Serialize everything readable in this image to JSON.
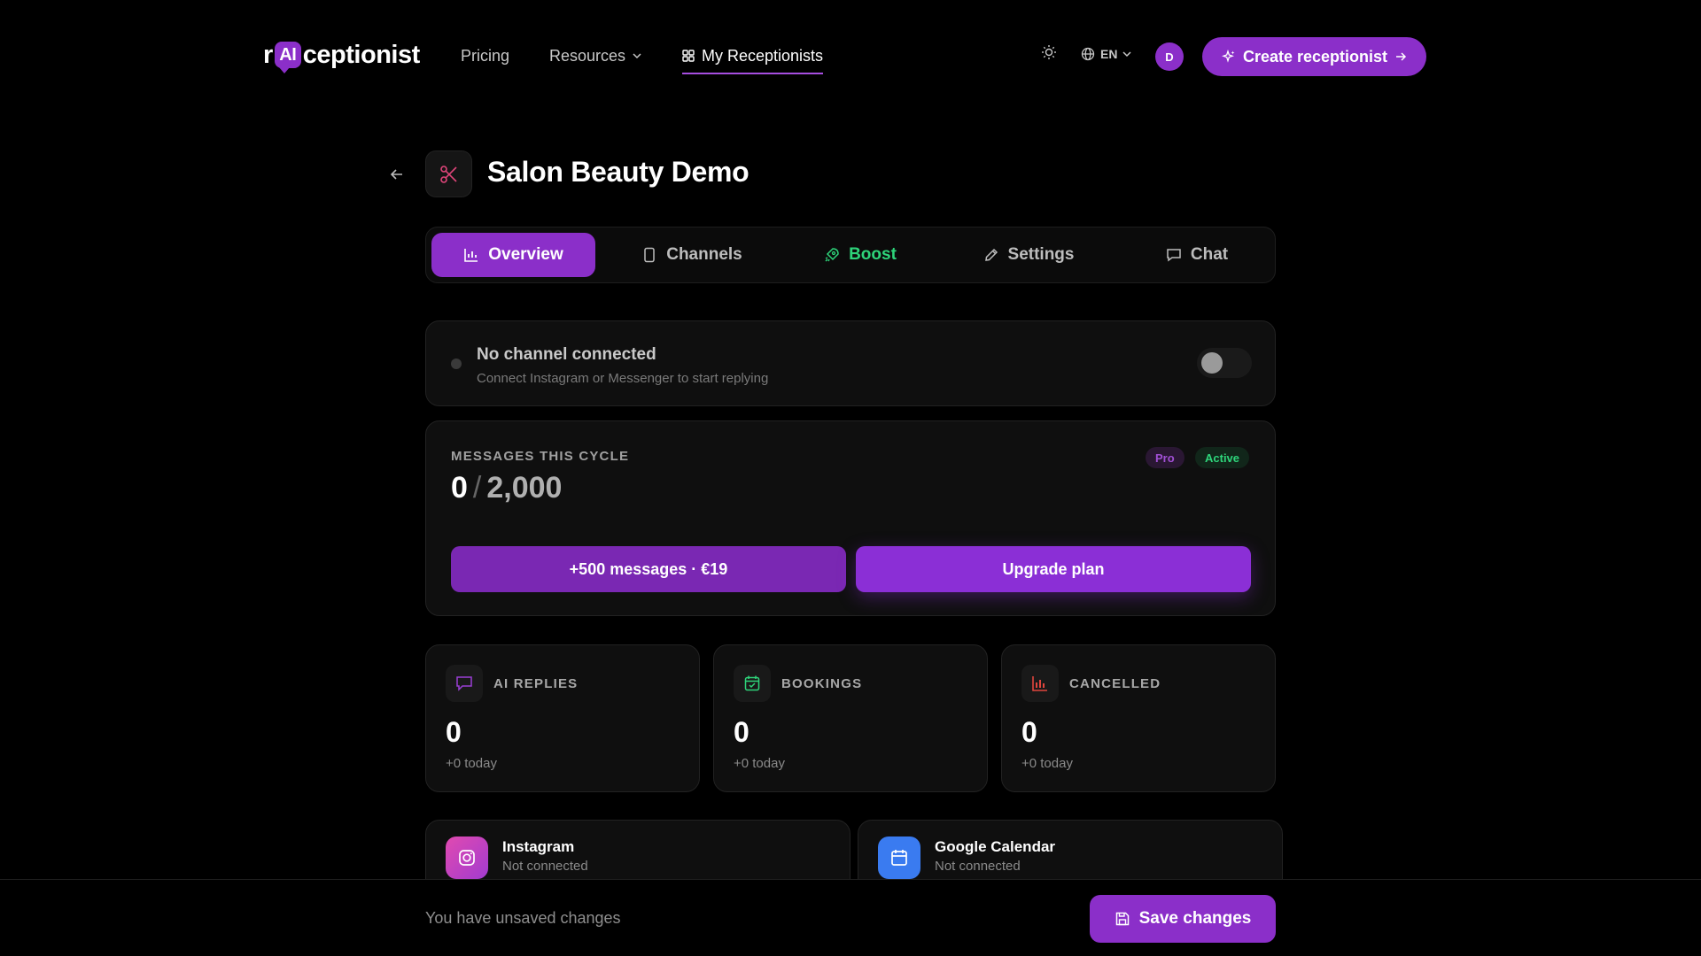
{
  "brand": {
    "logo_prefix": "r",
    "logo_ai": "AI",
    "logo_suffix": "ceptionist"
  },
  "nav": {
    "pricing": "Pricing",
    "resources": "Resources",
    "my_receptionists": "My Receptionists",
    "language": "EN",
    "avatar_initial": "D",
    "create_button": "Create receptionist"
  },
  "header": {
    "title": "Salon Beauty Demo"
  },
  "tabs": [
    {
      "label": "Overview",
      "active": true
    },
    {
      "label": "Channels"
    },
    {
      "label": "Boost",
      "color": "#2ed47a"
    },
    {
      "label": "Settings"
    },
    {
      "label": "Chat"
    }
  ],
  "status": {
    "title": "No channel connected",
    "subtitle": "Connect Instagram or Messenger to start replying",
    "enabled": false
  },
  "messages": {
    "label": "MESSAGES THIS CYCLE",
    "used": "0",
    "limit": "2,000",
    "badge_plan": "Pro",
    "badge_status": "Active",
    "buy_button": "+500 messages · €19",
    "upgrade_button": "Upgrade plan"
  },
  "stats": [
    {
      "label": "AI REPLIES",
      "value": "0",
      "sub": "+0 today",
      "icon": "chat-icon",
      "color": "#9b3fd6"
    },
    {
      "label": "BOOKINGS",
      "value": "0",
      "sub": "+0 today",
      "icon": "calendar-check-icon",
      "color": "#2ed47a"
    },
    {
      "label": "CANCELLED",
      "value": "0",
      "sub": "+0 today",
      "icon": "bar-chart-icon",
      "color": "#e0453d"
    }
  ],
  "integrations": [
    {
      "name": "Instagram",
      "status": "Not connected",
      "icon": "instagram-icon"
    },
    {
      "name": "Google Calendar",
      "status": "Not connected",
      "icon": "calendar-icon"
    }
  ],
  "bottom": {
    "unsaved_text": "You have unsaved changes",
    "save_button": "Save changes"
  },
  "colors": {
    "accent": "#8b2fc9",
    "success": "#2ed47a",
    "danger": "#e0453d",
    "background": "#000000"
  }
}
